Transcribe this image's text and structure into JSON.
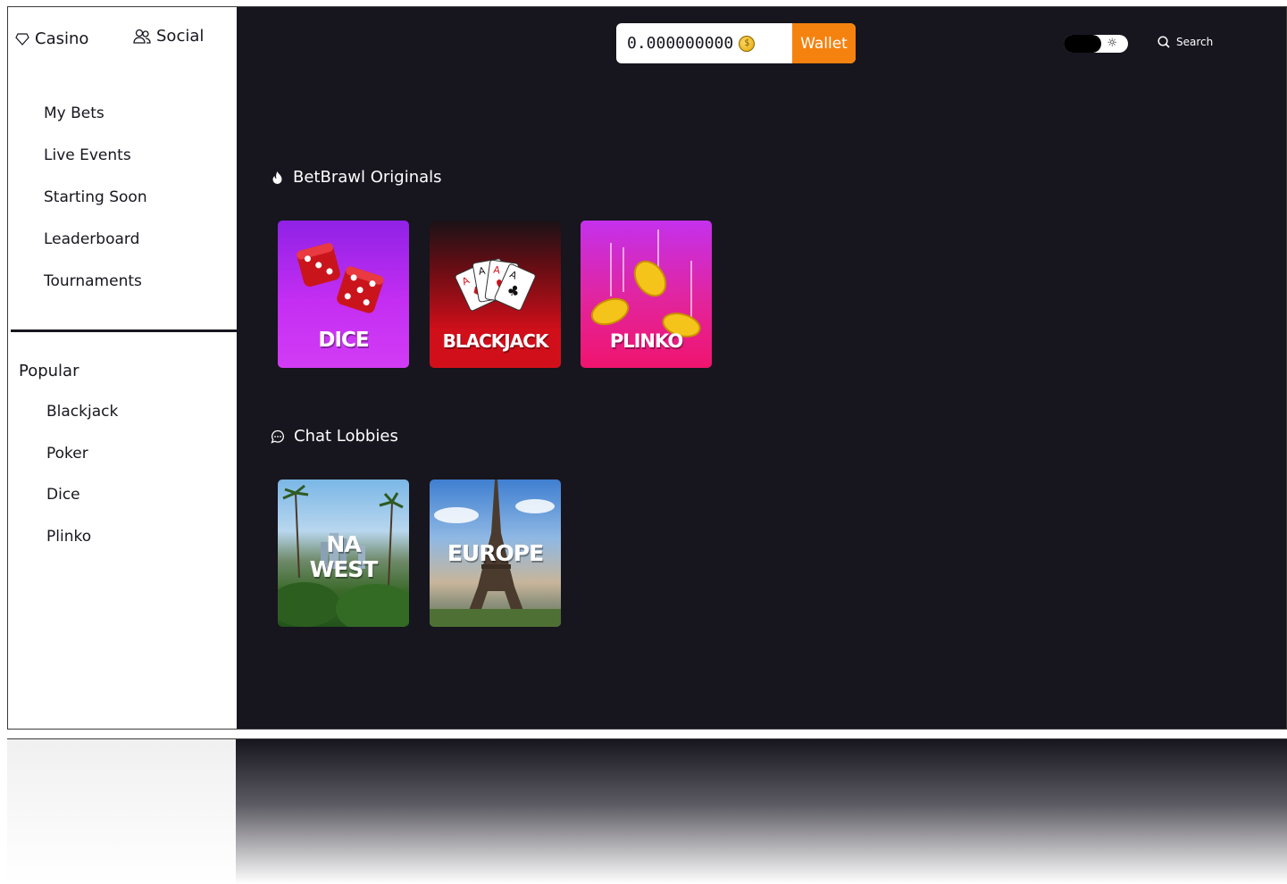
{
  "topnav": {
    "casino_label": "Casino",
    "social_label": "Social"
  },
  "menu": {
    "items": [
      {
        "label": "My Bets"
      },
      {
        "label": "Live Events"
      },
      {
        "label": "Starting Soon"
      },
      {
        "label": "Leaderboard"
      },
      {
        "label": "Tournaments"
      }
    ]
  },
  "popular": {
    "title": "Popular",
    "items": [
      {
        "label": "Blackjack"
      },
      {
        "label": "Poker"
      },
      {
        "label": "Dice"
      },
      {
        "label": "Plinko"
      }
    ]
  },
  "header": {
    "balance": "0.000000000",
    "coin_symbol": "$",
    "wallet_label": "Wallet",
    "search_label": "Search"
  },
  "originals": {
    "title": "BetBrawl Originals",
    "games": [
      {
        "label": "DICE"
      },
      {
        "label": "BLACKJACK"
      },
      {
        "label": "PLINKO"
      }
    ]
  },
  "lobbies": {
    "title": "Chat Lobbies",
    "items": [
      {
        "label_line1": "NA",
        "label_line2": "WEST"
      },
      {
        "label_line1": "EUROPE"
      }
    ]
  },
  "colors": {
    "background": "#17151e",
    "accent": "#f5820f",
    "dice_tile": "#c22ff0",
    "blackjack_tile": "#d10f1a",
    "plinko_tile": "#f0146e"
  }
}
